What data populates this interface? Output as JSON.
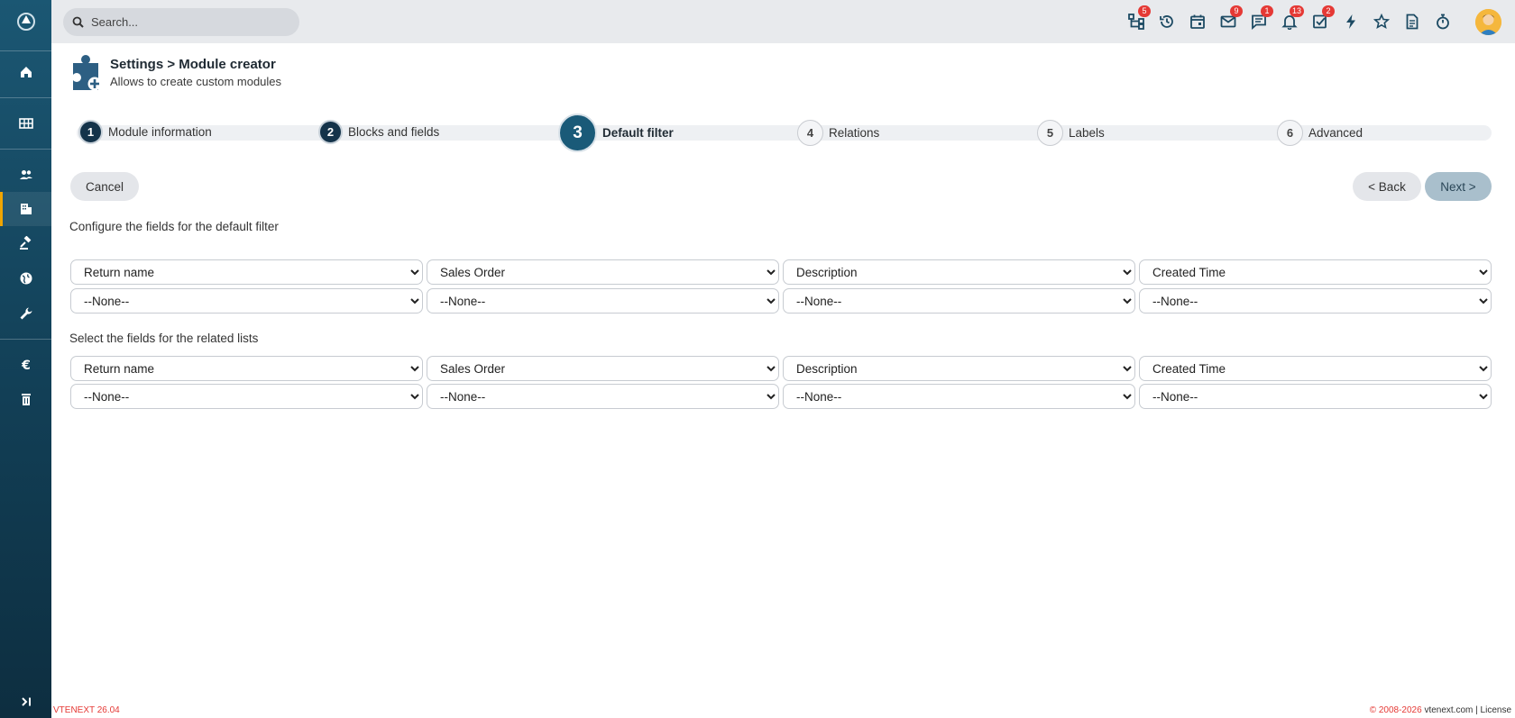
{
  "header": {
    "search_placeholder": "Search...",
    "badges": {
      "processes": "5",
      "mail": "9",
      "chat": "1",
      "notifications": "13",
      "tasks": "2"
    }
  },
  "page": {
    "title": "Settings > Module creator",
    "subtitle": "Allows to create custom modules"
  },
  "steps": [
    {
      "num": "1",
      "label": "Module information",
      "state": "done"
    },
    {
      "num": "2",
      "label": "Blocks and fields",
      "state": "done"
    },
    {
      "num": "3",
      "label": "Default filter",
      "state": "current"
    },
    {
      "num": "4",
      "label": "Relations",
      "state": "todo"
    },
    {
      "num": "5",
      "label": "Labels",
      "state": "todo"
    },
    {
      "num": "6",
      "label": "Advanced",
      "state": "todo"
    }
  ],
  "actions": {
    "cancel": "Cancel",
    "back": "< Back",
    "next": "Next >"
  },
  "default_filter": {
    "label": "Configure the fields for the default filter",
    "row1": [
      "Return name",
      "Sales Order",
      "Description",
      "Created Time"
    ],
    "row2": [
      "--None--",
      "--None--",
      "--None--",
      "--None--"
    ]
  },
  "related_lists": {
    "label": "Select the fields for the related lists",
    "row1": [
      "Return name",
      "Sales Order",
      "Description",
      "Created Time"
    ],
    "row2": [
      "--None--",
      "--None--",
      "--None--",
      "--None--"
    ]
  },
  "footer": {
    "version": "VTENEXT 26.04",
    "copyright": "© 2008-2026",
    "site": "vtenext.com",
    "sep": "|",
    "license": "License"
  },
  "colors": {
    "accent": "#1a5a78",
    "sidebar_active": "#f0a500",
    "badge": "#e53935"
  }
}
